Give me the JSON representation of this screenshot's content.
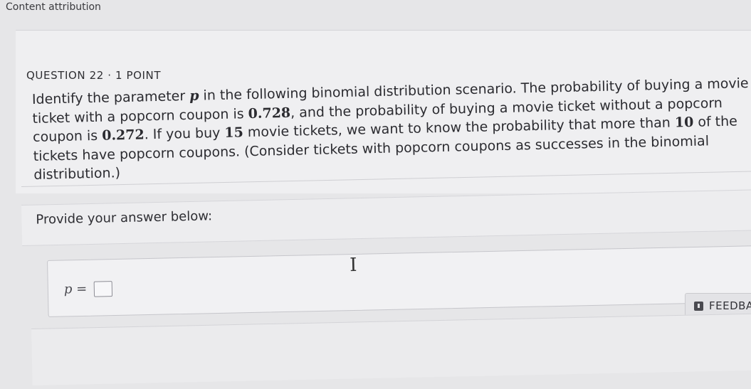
{
  "attribution": "Content attribution",
  "question": {
    "header": "QUESTION 22 · 1 POINT",
    "text_parts": {
      "t1": "Identify the parameter ",
      "p": "p",
      "t2": " in the following binomial distribution scenario. The probability of buying a movie ticket with a popcorn coupon is ",
      "v1": "0.728",
      "t3": ", and the probability of buying a movie ticket without a popcorn coupon is ",
      "v2": "0.272",
      "t4": ". If you buy ",
      "v3": "15",
      "t5": " movie tickets, we want to know the probability that more than ",
      "v4": "10",
      "t6": " of the tickets have popcorn coupons. (Consider tickets with popcorn coupons as successes in the binomial distribution.)"
    }
  },
  "answer": {
    "prompt": "Provide your answer below:",
    "label": "p =",
    "value": ""
  },
  "feedback": {
    "label": "FEEDBA"
  }
}
